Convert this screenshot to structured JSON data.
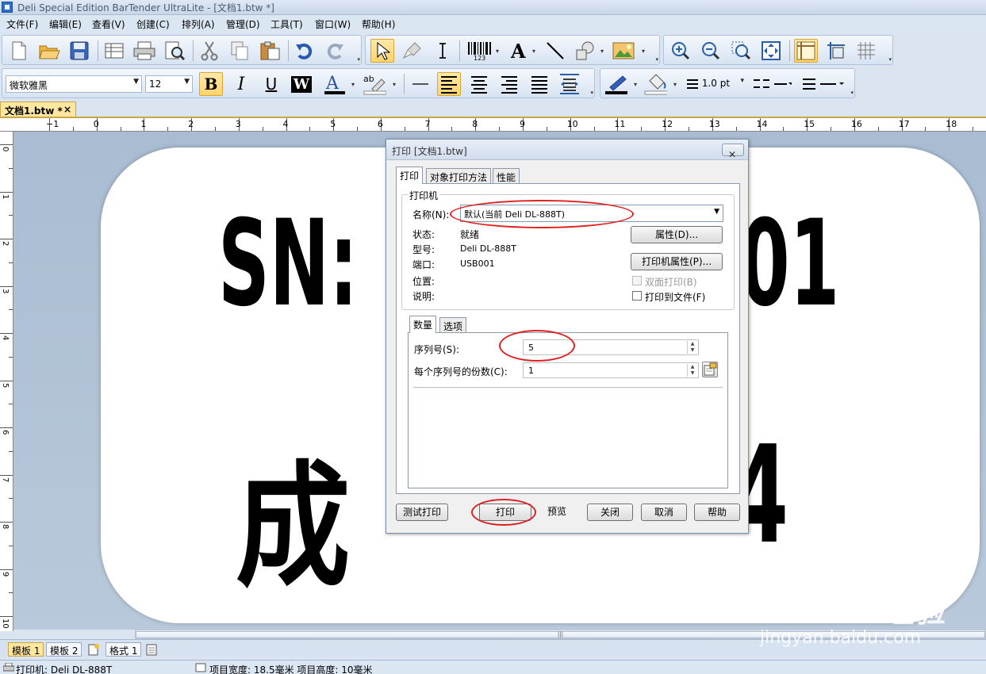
{
  "window": {
    "title": "Deli Special Edition BarTender UltraLite - [文档1.btw *]"
  },
  "menu": [
    "文件(F)",
    "编辑(E)",
    "查看(V)",
    "创建(C)",
    "排列(A)",
    "管理(D)",
    "工具(T)",
    "窗口(W)",
    "帮助(H)"
  ],
  "format_toolbar": {
    "font_name": "微软雅黑",
    "font_size": "12",
    "line_width": "1.0 pt"
  },
  "doc_tab": {
    "label": "文档1.btw *",
    "close": "×"
  },
  "ruler": {
    "h_numbers": [
      "−1",
      "0",
      "1",
      "2",
      "3",
      "4",
      "5",
      "6",
      "7",
      "8",
      "9",
      "10",
      "11",
      "12",
      "13",
      "14",
      "15",
      "16",
      "17",
      "18"
    ],
    "v_numbers": [
      "0",
      "1",
      "2",
      "3",
      "4",
      "5",
      "6",
      "7",
      "8",
      "9",
      "10"
    ]
  },
  "label_content": {
    "line1_left": "SN:",
    "line1_right": "01",
    "line2_left": "成",
    "line2_right": "4"
  },
  "dialog": {
    "title": "打印 [文档1.btw]",
    "close": "✕",
    "tabs": [
      "打印",
      "对象打印方法",
      "性能"
    ],
    "printer_group_title": "打印机",
    "name_label": "名称(N):",
    "printer_selected": "默认(当前 Deli DL-888T)",
    "status_label": "状态:",
    "status_value": "就绪",
    "model_label": "型号:",
    "model_value": "Deli DL-888T",
    "port_label": "端口:",
    "port_value": "USB001",
    "location_label": "位置:",
    "description_label": "说明:",
    "properties_button": "属性(D)...",
    "printer_properties_button": "打印机属性(P)...",
    "duplex_label": "双面打印(B)",
    "print_to_file_label": "打印到文件(F)",
    "sub_tabs": [
      "数量",
      "选项"
    ],
    "serial_label": "序列号(S):",
    "serial_value": "5",
    "copies_label": "每个序列号的份数(C):",
    "copies_value": "1",
    "buttons": {
      "test_print": "测试打印",
      "print": "打印",
      "preview": "预览",
      "close": "关闭",
      "cancel": "取消",
      "help": "帮助"
    }
  },
  "bottom_tabs": [
    "模板 1",
    "模板 2",
    "格式 1"
  ],
  "status_bar": {
    "printer": "打印机: Deli DL-888T",
    "item_size": "项目宽度: 18.5毫米  项目高度: 10毫米"
  },
  "watermark": {
    "brand": "Bai du 经验",
    "url": "jingyan.baidu.com"
  },
  "colors": {
    "annotation_red": "#e02020",
    "active_tool": "#ffd36b",
    "canvas_bg": "#b1c3d8"
  }
}
